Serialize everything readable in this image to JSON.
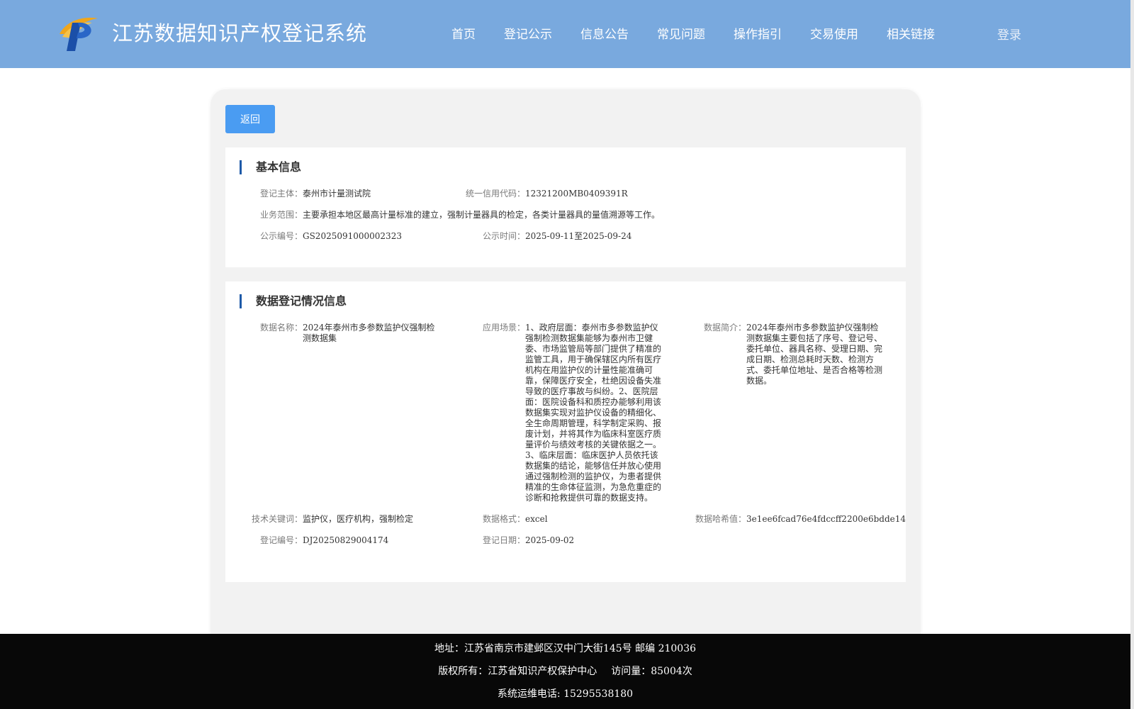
{
  "header": {
    "title": "江苏数据知识产权登记系统",
    "nav": [
      "首页",
      "登记公示",
      "信息公告",
      "常见问题",
      "操作指引",
      "交易使用",
      "相关链接"
    ],
    "login_label": "登录"
  },
  "back_label": "返回",
  "basic_info": {
    "title": "基本信息",
    "subject_label": "登记主体：",
    "subject_value": "泰州市计量测试院",
    "credit_code_label": "统一信用代码：",
    "credit_code_value": "12321200MB0409391R",
    "scope_label": "业务范围：",
    "scope_value": "主要承担本地区最高计量标准的建立，强制计量器具的检定，各类计量器具的量值溯源等工作。",
    "notice_no_label": "公示编号：",
    "notice_no_value": "GS2025091000002323",
    "notice_time_label": "公示时间：",
    "notice_time_value": "2025-09-11至2025-09-24"
  },
  "data_info": {
    "title": "数据登记情况信息",
    "name_label": "数据名称：",
    "name_value": "2024年泰州市多参数监护仪强制检测数据集",
    "scene_label": "应用场景：",
    "scene_value": "1、政府层面：泰州市多参数监护仪强制检测数据集能够为泰州市卫健委、市场监管局等部门提供了精准的监管工具，用于确保辖区内所有医疗机构在用监护仪的计量性能准确可靠，保障医疗安全，杜绝因设备失准导致的医疗事故与纠纷。2、医院层面：医院设备科和质控办能够利用该数据集实现对监护仪设备的精细化、全生命周期管理，科学制定采购、报废计划，并将其作为临床科室医疗质量评价与绩效考核的关键依据之一。3、临床层面：临床医护人员依托该数据集的结论，能够信任并放心使用通过强制检测的监护仪，为患者提供精准的生命体征监测，为急危重症的诊断和抢救提供可靠的数据支持。",
    "intro_label": "数据简介：",
    "intro_value": "2024年泰州市多参数监护仪强制检测数据集主要包括了序号、登记号、委托单位、器具名称、受理日期、完成日期、检测总耗时天数、检测方式、委托单位地址、是否合格等检测数据。",
    "keywords_label": "技术关键词：",
    "keywords_value": "监护仪，医疗机构，强制检定",
    "format_label": "数据格式：",
    "format_value": "excel",
    "hash_label": "数据哈希值：",
    "hash_value": "3e1ee6fcad76e4fdccff2200e6bdde14",
    "reg_no_label": "登记编号：",
    "reg_no_value": "DJ20250829004174",
    "reg_date_label": "登记日期：",
    "reg_date_value": "2025-09-02"
  },
  "footer": {
    "address": "地址：江苏省南京市建邺区汉中门大街145号 邮编 210036",
    "copyright": "版权所有：江苏省知识产权保护中心",
    "visits": "访问量：85004次",
    "phone": "系统运维电话: 15295538180"
  },
  "colors": {
    "header_bg": "#79a9de",
    "button_blue": "#4a9cf2",
    "accent_bar": "#1e5aa8",
    "footer_bg": "#080808"
  }
}
